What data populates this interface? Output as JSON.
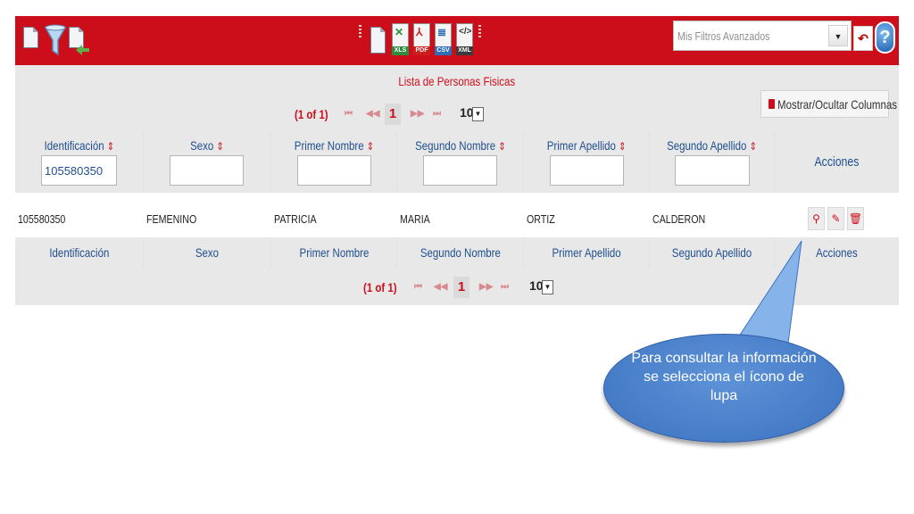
{
  "toolbar": {
    "icons": [
      "new-document-icon",
      "filter-icon",
      "export-back-icon"
    ],
    "exports": [
      {
        "name": "xls-export-icon",
        "tag": "XLS",
        "color": "#2e8b3e"
      },
      {
        "name": "pdf-export-icon",
        "tag": "PDF",
        "color": "#cc1f1f"
      },
      {
        "name": "csv-export-icon",
        "tag": "CSV",
        "color": "#2f6db5"
      },
      {
        "name": "xml-export-icon",
        "tag": "XML",
        "color": "#3a3a3a"
      }
    ],
    "filter_placeholder": "Mis Filtros Avanzados",
    "reset_icon": "undo-icon",
    "help_label": "?",
    "color": "#cc0e1b"
  },
  "table": {
    "caption": "Lista de Personas Fisicas",
    "pager": {
      "count": "(1 of 1)",
      "first": "⏮",
      "prev": "◀◀",
      "page": "1",
      "next": "▶▶",
      "last": "⏭",
      "rows_per_page": "10"
    },
    "toggle_columns_label": "Mostrar/Ocultar Columnas",
    "columns": [
      "Identificación",
      "Sexo",
      "Primer Nombre",
      "Segundo Nombre",
      "Primer Apellido",
      "Segundo Apellido"
    ],
    "actions_label": "Acciones",
    "filters": {
      "identificacion": "105580350"
    },
    "rows": [
      [
        "105580350",
        "FEMENINO",
        "PATRICIA",
        "MARIA",
        "ORTIZ",
        "CALDERON"
      ]
    ],
    "action_icons": [
      "search-icon",
      "edit-icon",
      "delete-icon"
    ]
  },
  "callout": {
    "text": "Para consultar la información se selecciona el ícono de lupa"
  }
}
